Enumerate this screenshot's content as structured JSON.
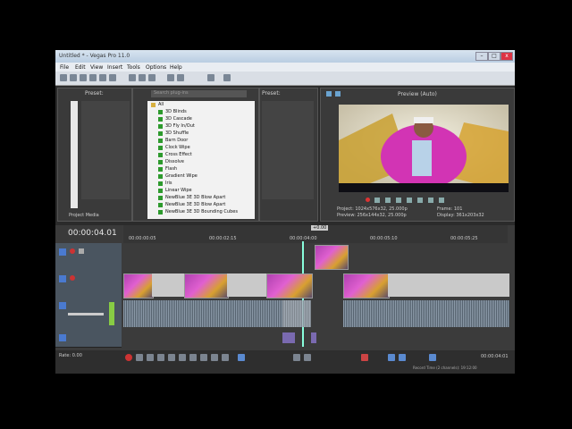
{
  "window": {
    "title": "Untitled * - Vegas Pro 11.0",
    "min": "–",
    "max": "□",
    "close": "x"
  },
  "menu": [
    "File",
    "Edit",
    "View",
    "Insert",
    "Tools",
    "Options",
    "Help"
  ],
  "left_panel": {
    "preset": "Preset:",
    "tab": "Project Media"
  },
  "transitions": {
    "search_placeholder": "Search plug-ins",
    "root": "All",
    "items": [
      "3D Blinds",
      "3D Cascade",
      "3D Fly In/Out",
      "3D Shuffle",
      "Barn Door",
      "Clock Wipe",
      "Cross Effect",
      "Dissolve",
      "Flash",
      "Gradient Wipe",
      "Iris",
      "Linear Wipe",
      "NewBlue 3E 3D Blow Apart",
      "NewBlue 3E 3D Blow Apart",
      "NewBlue 3E 3D Bounding Cubes"
    ]
  },
  "preset_panel": {
    "label": "Preset:"
  },
  "preview": {
    "mode": "Preview (Auto)",
    "project": "Project: 1024x576x32, 25.000p",
    "preview_res": "Preview: 256x144x32, 25.000p",
    "frame": "Frame: 101",
    "display": "Display: 361x203x32"
  },
  "timeline": {
    "timecode": "00:00:04.01",
    "marker": "+0.00",
    "ticks": [
      "00:00:00:05",
      "00:00:02:15",
      "00:00:04:00",
      "00:00:05:10",
      "00:00:05:25"
    ],
    "rate": "Rate: 0.00",
    "end_time": "00:00:04:01",
    "status": "Record Time (2 channels): 19:12:00"
  }
}
